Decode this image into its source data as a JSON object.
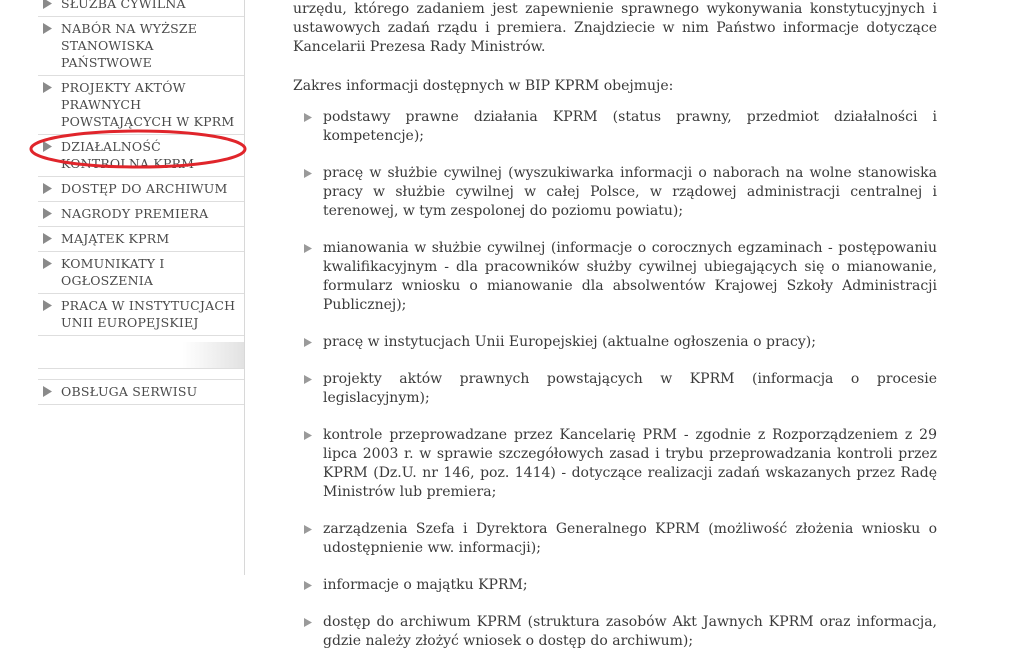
{
  "sidebar": {
    "items": [
      {
        "label": "SŁUŻBA CYWILNA"
      },
      {
        "label": "NABÓR NA WYŻSZE STANOWISKA PAŃSTWOWE"
      },
      {
        "label": "PROJEKTY AKTÓW PRAWNYCH POWSTAJĄCYCH W KPRM"
      },
      {
        "label": "DZIAŁALNOŚĆ KONTROLNA KPRM"
      },
      {
        "label": "DOSTĘP DO ARCHIWUM"
      },
      {
        "label": "NAGRODY PREMIERA"
      },
      {
        "label": "MAJĄTEK KPRM"
      },
      {
        "label": "KOMUNIKATY I OGŁOSZENIA"
      },
      {
        "label": "PRACA W INSTYTUCJACH UNII EUROPEJSKIEJ"
      }
    ],
    "service": {
      "label": "OBSŁUGA SERWISU"
    },
    "highlight_color": "#e0252b",
    "arrow_color": "#8a8a8a"
  },
  "content": {
    "intro": "urzędu, którego zadaniem jest zapewnienie sprawnego wykonywania konstytucyjnych i ustawowych zadań rządu i premiera. Znajdziecie w nim Państwo informacje dotyczące Kancelarii Prezesa Rady Ministrów.",
    "lead": "Zakres informacji dostępnych w BIP KPRM obejmuje:",
    "bullets": [
      "podstawy prawne działania KPRM (status prawny, przedmiot działalności i kompetencje);",
      "pracę w służbie cywilnej (wyszukiwarka informacji o naborach na wolne stanowiska pracy w służbie cywilnej w całej Polsce, w rządowej administracji centralnej i terenowej, w tym zespolonej do poziomu powiatu);",
      "mianowania w służbie cywilnej (informacje o corocznych egzaminach - postępowaniu kwalifikacyjnym - dla pracowników służby cywilnej ubiegających się o mianowanie, formularz wniosku o mianowanie dla absolwentów Krajowej Szkoły Administracji Publicznej);",
      "pracę w instytucjach Unii Europejskiej (aktualne ogłoszenia o pracy);",
      "projekty aktów prawnych powstających w KPRM (informacja o procesie legislacyjnym);",
      "kontrole przeprowadzane przez Kancelarię PRM - zgodnie z Rozporządzeniem z 29 lipca 2003 r. w sprawie szczegółowych zasad i trybu przeprowadzania kontroli przez KPRM (Dz.U. nr 146, poz. 1414) - dotyczące realizacji zadań wskazanych przez Radę Ministrów lub premiera;",
      "zarządzenia Szefa i Dyrektora Generalnego KPRM (możliwość złożenia wniosku o udostępnienie ww. informacji);",
      "informacje o majątku KPRM;",
      "dostęp do archiwum KPRM (struktura zasobów Akt Jawnych KPRM oraz informacja, gdzie należy złożyć wniosek o dostęp do archiwum);"
    ]
  }
}
